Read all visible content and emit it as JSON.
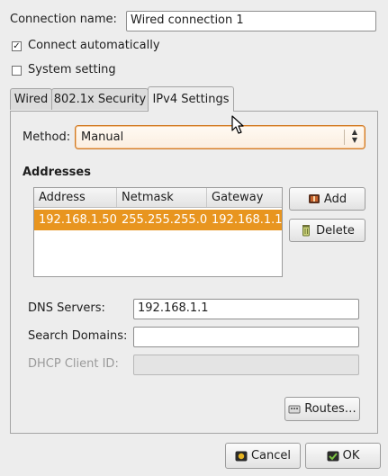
{
  "connection": {
    "name_label": "Connection name:",
    "name_value": "Wired connection 1",
    "connect_auto_label": "Connect automatically",
    "connect_auto_checked": true,
    "connect_auto_mark": "✓",
    "system_setting_label": "System setting",
    "system_setting_checked": false
  },
  "tabs": [
    {
      "label": "Wired",
      "active": false
    },
    {
      "label": "802.1x Security",
      "active": false
    },
    {
      "label": "IPv4 Settings",
      "active": true
    }
  ],
  "ipv4": {
    "method_label": "Method:",
    "method_value": "Manual",
    "addresses_heading": "Addresses",
    "table": {
      "columns": [
        "Address",
        "Netmask",
        "Gateway"
      ],
      "rows": [
        {
          "address": "192.168.1.50",
          "netmask": "255.255.255.0",
          "gateway": "192.168.1.1",
          "selected": true
        }
      ]
    },
    "add_button": "Add",
    "delete_button": "Delete",
    "dns_label": "DNS Servers:",
    "dns_value": "192.168.1.1",
    "search_domains_label": "Search Domains:",
    "search_domains_value": "",
    "dhcp_client_id_label": "DHCP Client ID:",
    "dhcp_client_id_value": "",
    "dhcp_client_id_enabled": false,
    "routes_button": "Routes…"
  },
  "dialog_buttons": {
    "cancel": "Cancel",
    "ok": "OK"
  },
  "icons": {
    "add": "add-icon",
    "delete": "trash-icon",
    "routes": "routes-icon",
    "cancel": "cancel-icon",
    "ok": "ok-icon",
    "pointer": "mouse-pointer-icon"
  },
  "colors": {
    "accent": "#e8951f",
    "focus_border": "#d07a24",
    "window_bg": "#ededed"
  }
}
